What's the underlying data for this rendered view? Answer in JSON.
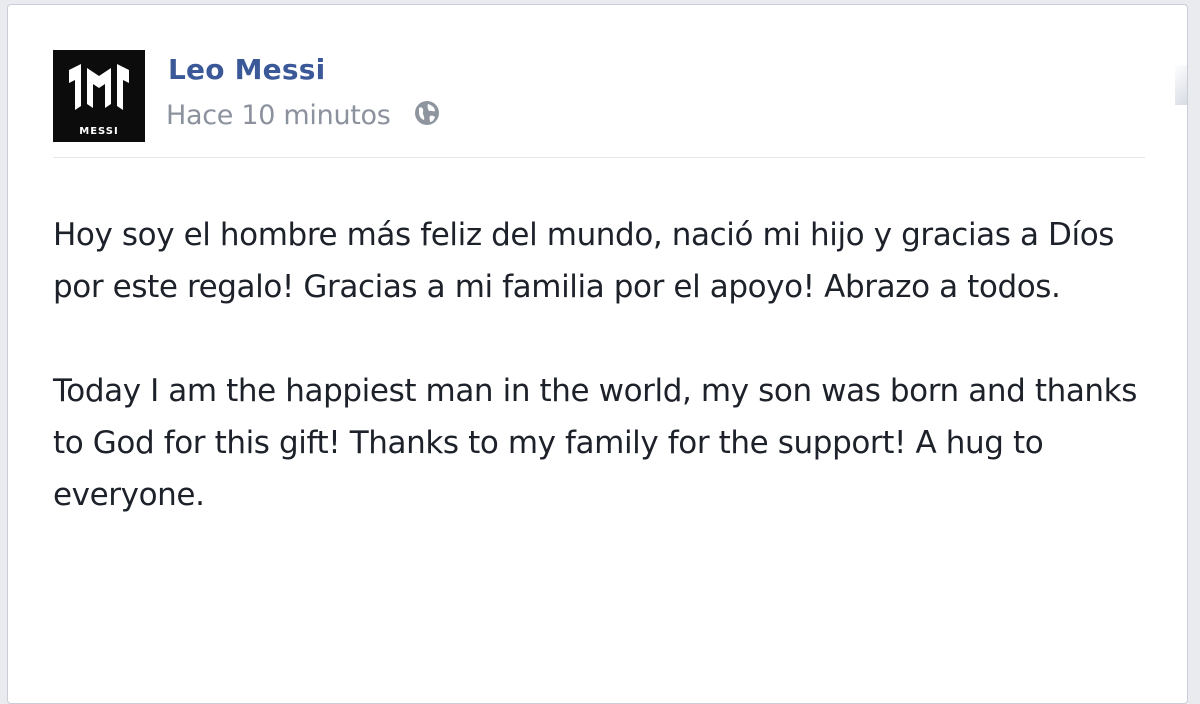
{
  "post": {
    "author": "Leo Messi",
    "timestamp": "Hace 10 minutos",
    "audience_icon": "globe-icon",
    "avatar_icon": "messi-logo-icon",
    "avatar_logo_text": "MESSI",
    "paragraphs": [
      "Hoy soy el hombre más feliz del mundo, nació mi hijo y gracias a Díos por este regalo! Gracias a mi familia por el apoyo! Abrazo a todos.",
      "Today I am the happiest man in the world, my son was born and thanks to God for this gift! Thanks to my family for the support! A hug to everyone."
    ]
  },
  "colors": {
    "author_name": "#3b5998",
    "timestamp": "#8c929d",
    "body_text": "#1d2129",
    "avatar_bg": "#0c0c0c"
  }
}
